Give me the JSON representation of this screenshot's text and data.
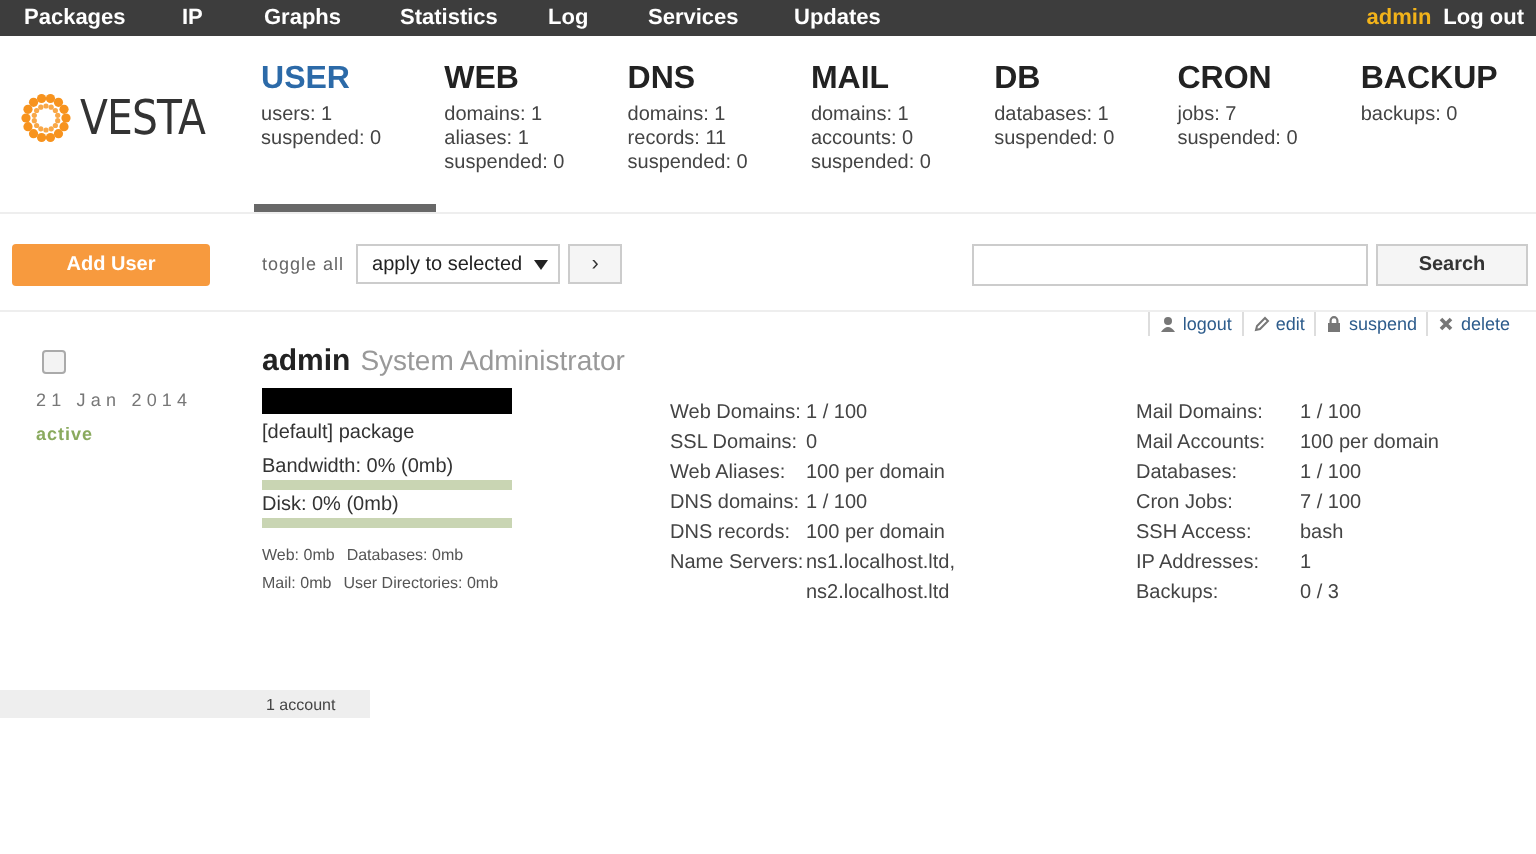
{
  "top_menu": {
    "items": [
      {
        "label": "Packages"
      },
      {
        "label": "IP"
      },
      {
        "label": "Graphs"
      },
      {
        "label": "Statistics"
      },
      {
        "label": "Log"
      },
      {
        "label": "Services"
      },
      {
        "label": "Updates"
      }
    ],
    "user": "admin",
    "logout": "Log out"
  },
  "logo": "VESTA",
  "sections": [
    {
      "title": "USER",
      "selected": true,
      "stats": [
        "users: 1",
        "suspended: 0"
      ]
    },
    {
      "title": "WEB",
      "selected": false,
      "stats": [
        "domains: 1",
        "aliases: 1",
        "suspended: 0"
      ]
    },
    {
      "title": "DNS",
      "selected": false,
      "stats": [
        "domains: 1",
        "records: 11",
        "suspended: 0"
      ]
    },
    {
      "title": "MAIL",
      "selected": false,
      "stats": [
        "domains: 1",
        "accounts: 0",
        "suspended: 0"
      ]
    },
    {
      "title": "DB",
      "selected": false,
      "stats": [
        "databases: 1",
        "suspended: 0"
      ]
    },
    {
      "title": "CRON",
      "selected": false,
      "stats": [
        "jobs: 7",
        "suspended: 0"
      ]
    },
    {
      "title": "BACKUP",
      "selected": false,
      "stats": [
        "backups: 0"
      ]
    }
  ],
  "toolbar": {
    "add_button": "Add User",
    "toggle_all": "toggle all",
    "bulk_action": "apply to selected",
    "apply_button": "›",
    "search_button": "Search"
  },
  "user_row": {
    "checked": false,
    "date": "21 Jan 2014",
    "status": "active",
    "actions": [
      {
        "kind": "person",
        "label": "logout"
      },
      {
        "kind": "pencil",
        "label": "edit"
      },
      {
        "kind": "lock",
        "label": "suspend"
      },
      {
        "kind": "cross",
        "label": "delete"
      }
    ],
    "username": "admin",
    "full_name": "System Administrator",
    "package": "[default] package",
    "meters": [
      {
        "label": "Bandwidth: 0% (0mb)",
        "level": 0
      },
      {
        "label": "Disk: 0% (0mb)",
        "level": 0
      }
    ],
    "usage": [
      [
        "Web: 0mb",
        "Databases: 0mb"
      ],
      [
        "Mail: 0mb",
        "User Directories: 0mb"
      ]
    ],
    "stats_left": [
      {
        "label": "Web Domains:",
        "values": [
          "1 / 100"
        ]
      },
      {
        "label": "SSL Domains:",
        "values": [
          "0"
        ]
      },
      {
        "label": "Web Aliases:",
        "values": [
          "100 per domain"
        ]
      },
      {
        "label": "DNS domains:",
        "values": [
          "1 / 100"
        ]
      },
      {
        "label": "DNS records:",
        "values": [
          "100 per domain"
        ]
      },
      {
        "label": "Name Servers:",
        "values": [
          "ns1.localhost.ltd,",
          "ns2.localhost.ltd"
        ]
      }
    ],
    "stats_right": [
      {
        "label": "Mail Domains:",
        "values": [
          "1 / 100"
        ]
      },
      {
        "label": "Mail Accounts:",
        "values": [
          "100 per domain"
        ]
      },
      {
        "label": "Databases:",
        "values": [
          "1 / 100"
        ]
      },
      {
        "label": "Cron Jobs:",
        "values": [
          "7 / 100"
        ]
      },
      {
        "label": "SSH Access:",
        "values": [
          "bash"
        ]
      },
      {
        "label": "IP Addresses:",
        "values": [
          "1"
        ]
      },
      {
        "label": "Backups:",
        "values": [
          "0 / 3"
        ]
      }
    ]
  },
  "footer": {
    "count": "1 account"
  }
}
